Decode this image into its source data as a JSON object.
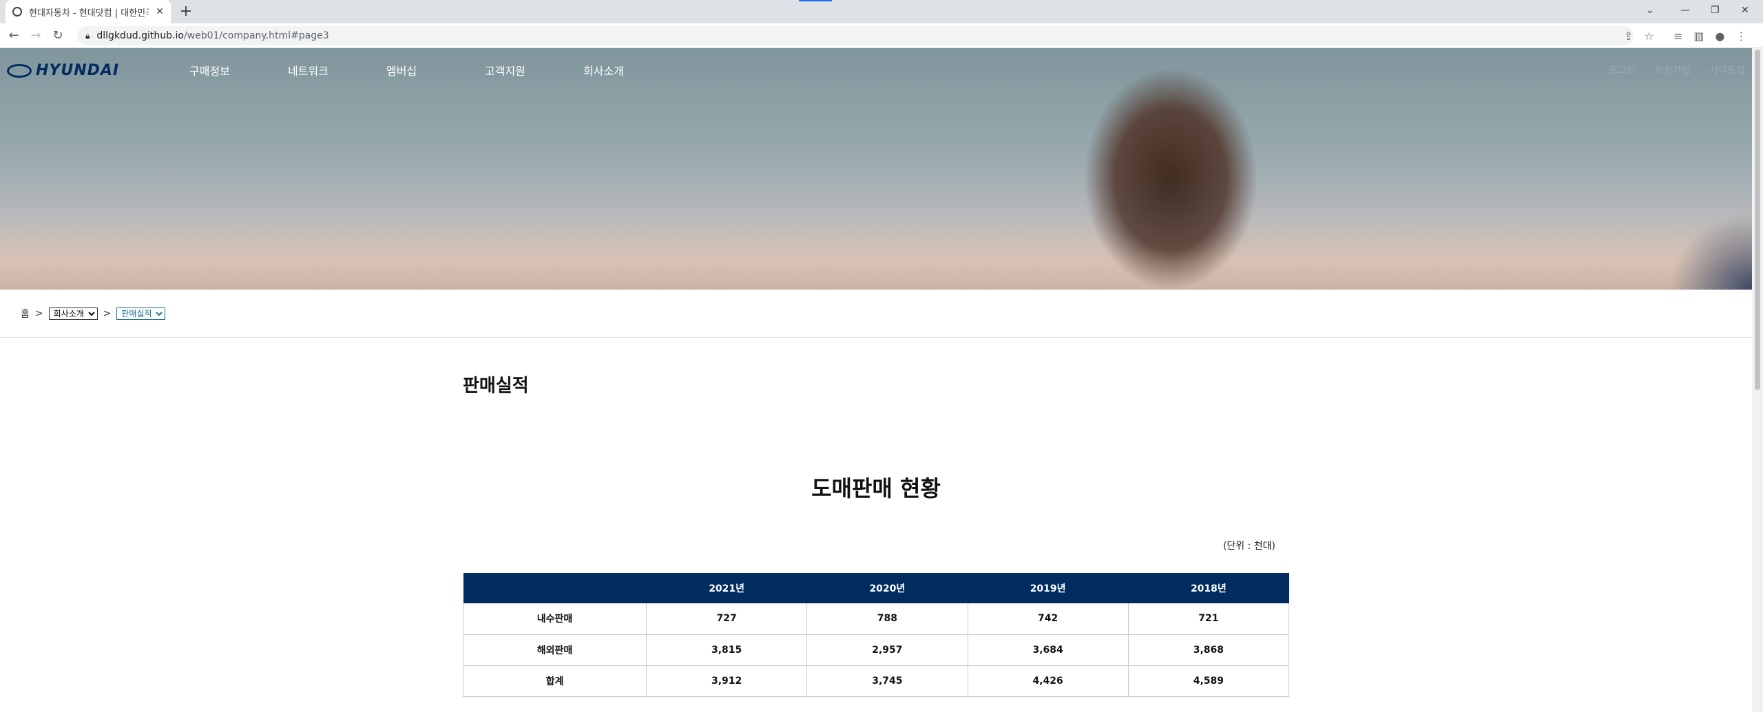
{
  "browser": {
    "tab_title": "현대자동차 - 현대닷컴 | 대한민국",
    "new_tab": "+",
    "url_host": "dllgkdud.github.io",
    "url_path": "/web01/company.html#page3"
  },
  "header": {
    "logo": "HYUNDAI",
    "nav": [
      "구매정보",
      "네트워크",
      "멤버십",
      "고객지원",
      "회사소개"
    ],
    "util": [
      "로그인",
      "회원가입",
      "사이트맵"
    ]
  },
  "breadcrumb": {
    "home": "홈",
    "sep": ">",
    "level1": "회사소개",
    "level2": "판매실적"
  },
  "section": {
    "title": "판매실적",
    "chart_title": "도매판매 현황",
    "unit": "(단위 : 천대)"
  },
  "table": {
    "columns": [
      "",
      "2021년",
      "2020년",
      "2019년",
      "2018년"
    ],
    "rows": [
      {
        "label": "내수판매",
        "values": [
          "727",
          "788",
          "742",
          "721"
        ]
      },
      {
        "label": "해외판매",
        "values": [
          "3,815",
          "2,957",
          "3,684",
          "3,868"
        ]
      },
      {
        "label": "합계",
        "values": [
          "3,912",
          "3,745",
          "4,426",
          "4,589"
        ]
      }
    ]
  },
  "colors": {
    "brand": "#002c5f",
    "breadcrumb_active": "#1c6c8c"
  }
}
